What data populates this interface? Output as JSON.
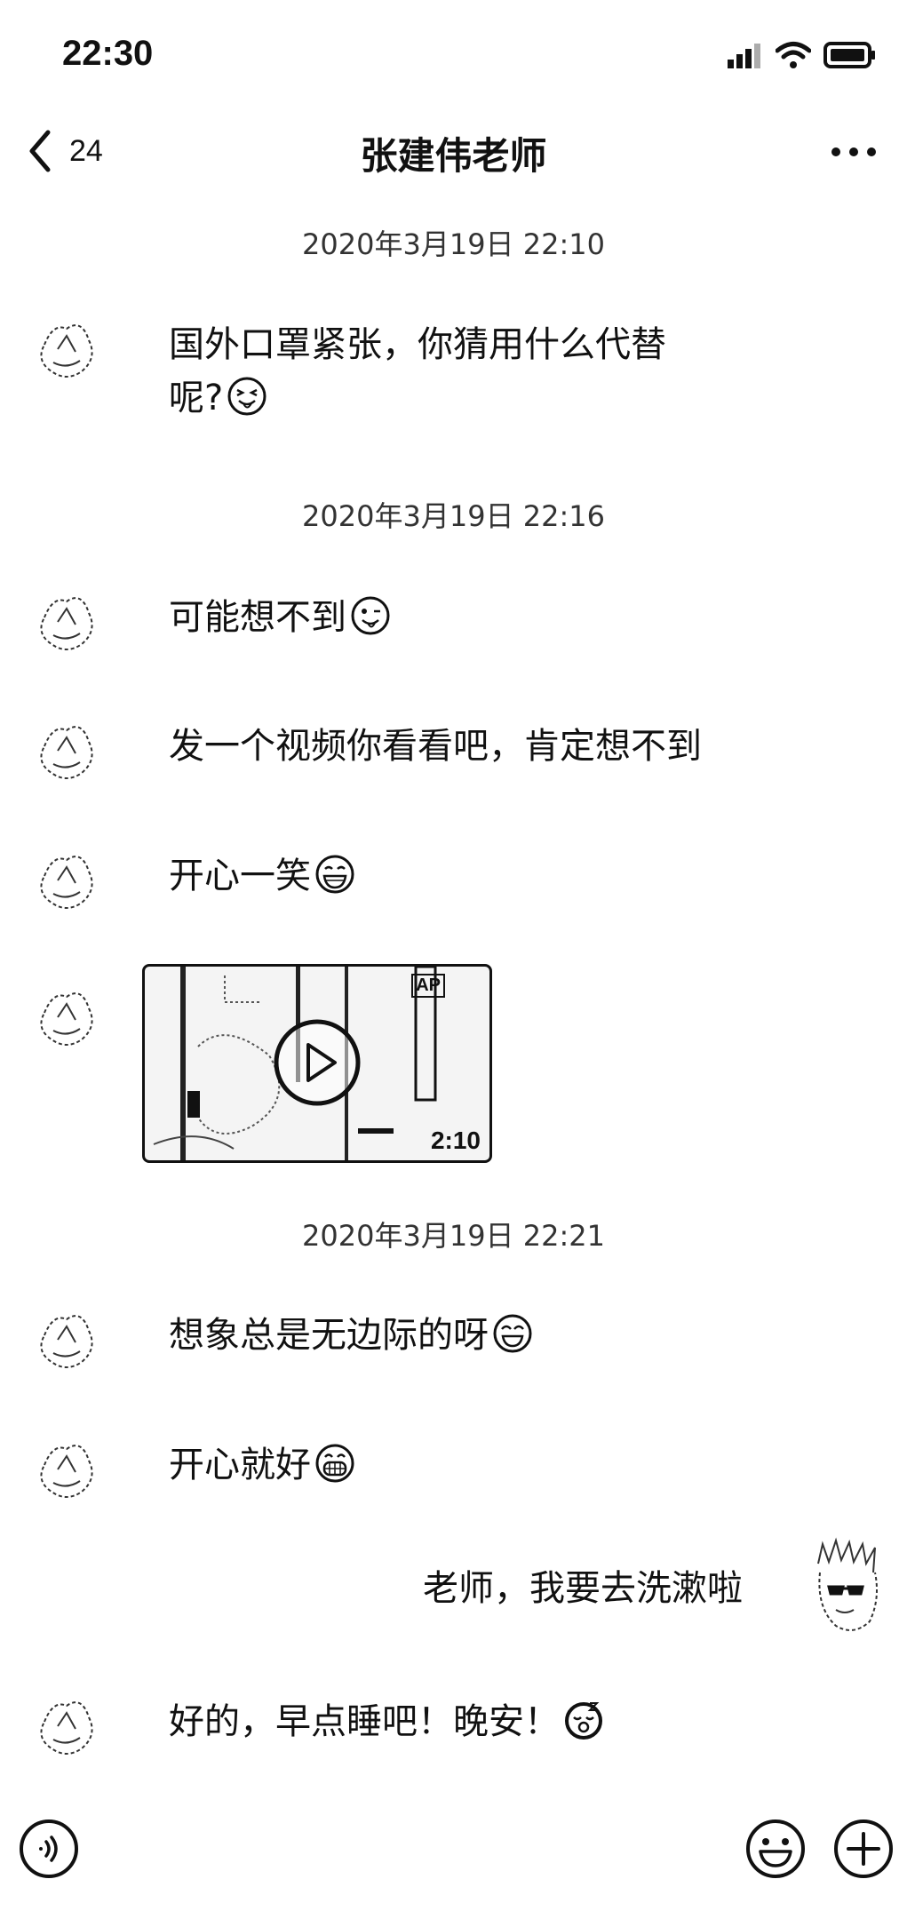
{
  "status_bar": {
    "time": "22:30"
  },
  "nav": {
    "back_count": "24",
    "title": "张建伟老师"
  },
  "timestamps": [
    "2020年3月19日 22:10",
    "2020年3月19日 22:16",
    "2020年3月19日 22:21"
  ],
  "messages": [
    {
      "sender": "teacher",
      "line1": "国外口罩紧张，你猜用什么代替",
      "line2": "呢?",
      "emoji": "squinting-tongue-emoji"
    },
    {
      "sender": "teacher",
      "text": "可能想不到",
      "emoji": "winking-tongue-emoji"
    },
    {
      "sender": "teacher",
      "text": "发一个视频你看看吧，肯定想不到"
    },
    {
      "sender": "teacher",
      "text": "开心一笑",
      "emoji": "grinning-emoji"
    },
    {
      "sender": "teacher",
      "type": "video",
      "duration": "2:10",
      "badge": "AP"
    },
    {
      "sender": "teacher",
      "text": "想象总是无边际的呀",
      "emoji": "smiling-emoji"
    },
    {
      "sender": "teacher",
      "text": "开心就好",
      "emoji": "big-grin-emoji"
    },
    {
      "sender": "me",
      "text": "老师，我要去洗漱啦"
    },
    {
      "sender": "teacher",
      "text": "好的，早点睡吧！晚安！",
      "emoji": "sleeping-emoji"
    }
  ],
  "icons": {
    "voice": "voice-icon",
    "emoji_button": "emoji-icon",
    "add_button": "add-icon"
  }
}
